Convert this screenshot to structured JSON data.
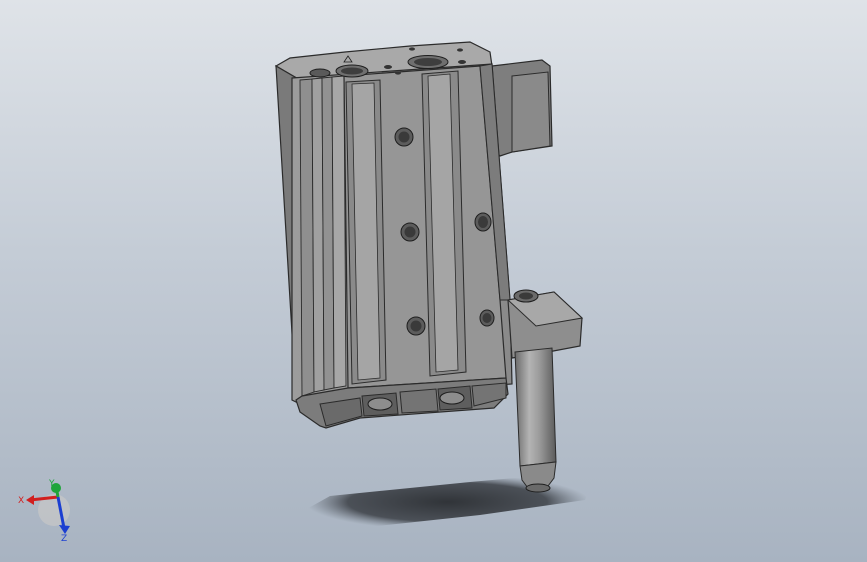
{
  "viewport": {
    "background_top": "#dfe3e8",
    "background_bottom": "#a8b3c1",
    "model_color": "#8c8c8c"
  },
  "triad": {
    "x_label": "X",
    "y_label": "Y",
    "z_label": "Z",
    "x_color": "#d11f1f",
    "y_color": "#1fa53a",
    "z_color": "#1c3fd1"
  }
}
